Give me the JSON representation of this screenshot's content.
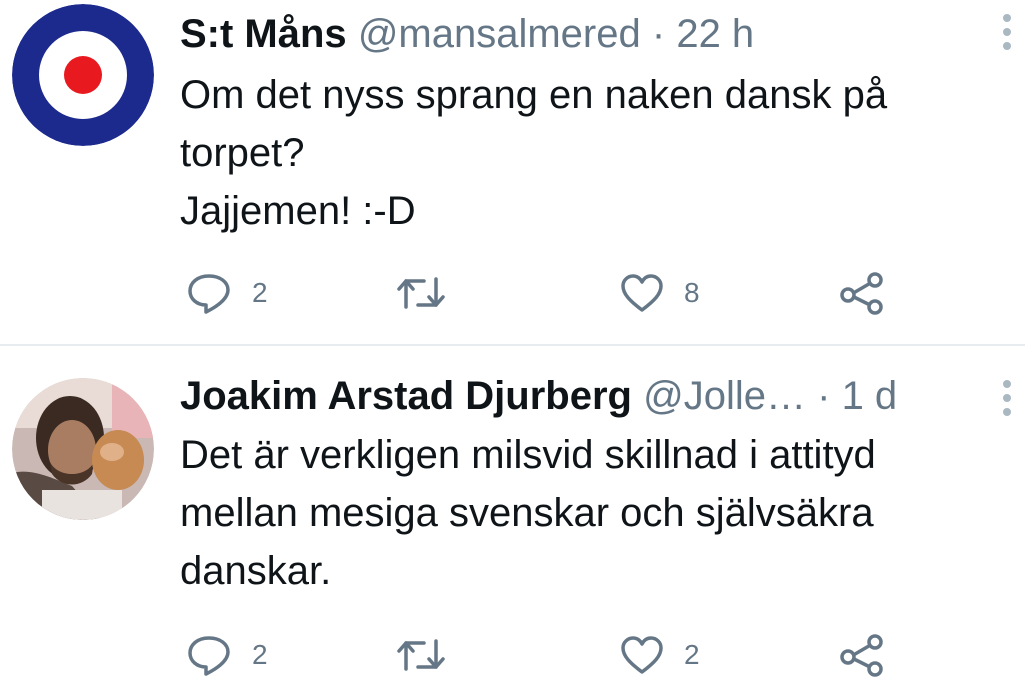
{
  "tweets": [
    {
      "name": "S:t Måns",
      "handle": "@mansalmered",
      "separator": "·",
      "time": "22 h",
      "lines": [
        "Om det nyss sprang en naken dansk på",
        "torpet?",
        "Jajjemen! :-D"
      ],
      "replies": "2",
      "likes": "8",
      "avatar_icon": "roundel-avatar",
      "colors": {
        "roundel_outer": "#1c2a8e",
        "roundel_ring": "#ffffff",
        "roundel_center": "#e8191f"
      }
    },
    {
      "name": "Joakim Arstad Djurberg",
      "handle": "@Jolle…",
      "separator": " ·",
      "time": "1 d",
      "lines": [
        "Det är verkligen milsvid skillnad i attityd",
        "mellan mesiga svenskar och självsäkra",
        "danskar."
      ],
      "replies": "2",
      "likes": "2",
      "avatar_icon": "photo-avatar"
    }
  ],
  "icons": {
    "reply": "reply-icon",
    "retweet": "retweet-icon",
    "like": "like-icon",
    "share": "share-icon",
    "more": "more-vertical-icon"
  },
  "colors": {
    "text": "#0f1419",
    "secondary": "#657786",
    "divider": "#e6ecf0"
  }
}
